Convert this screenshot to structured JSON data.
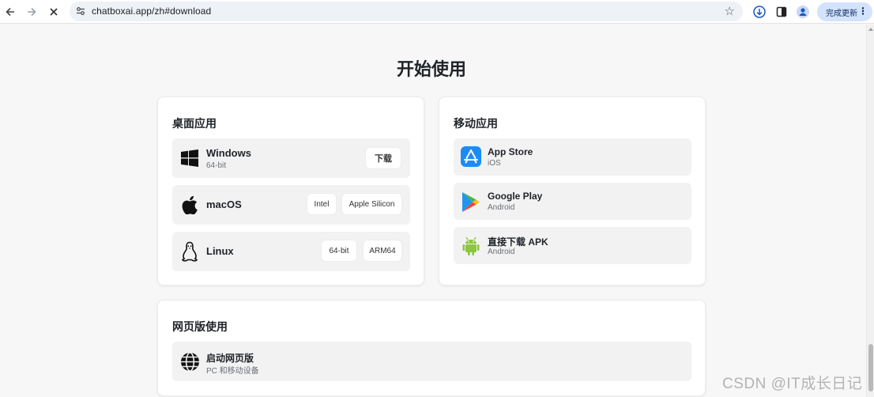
{
  "browser": {
    "url": "chatboxai.app/zh#download",
    "update_label": "完成更新"
  },
  "page": {
    "heading": "开始使用",
    "desktop": {
      "title": "桌面应用",
      "windows": {
        "name": "Windows",
        "sub": "64-bit",
        "download": "下载"
      },
      "macos": {
        "name": "macOS",
        "intel": "Intel",
        "silicon": "Apple Silicon"
      },
      "linux": {
        "name": "Linux",
        "x64": "64-bit",
        "arm": "ARM64"
      }
    },
    "mobile": {
      "title": "移动应用",
      "appstore": {
        "name": "App Store",
        "sub": "iOS"
      },
      "googleplay": {
        "name": "Google Play",
        "sub": "Android"
      },
      "apk": {
        "name": "直接下载 APK",
        "sub": "Android"
      }
    },
    "web": {
      "title": "网页版使用",
      "launch": {
        "name": "启动网页版",
        "sub": "PC 和移动设备"
      }
    }
  },
  "watermark": "CSDN @IT成长日记",
  "colors": {
    "appstore_blue": "#1a8cf5",
    "android_green": "#8cc63e"
  }
}
